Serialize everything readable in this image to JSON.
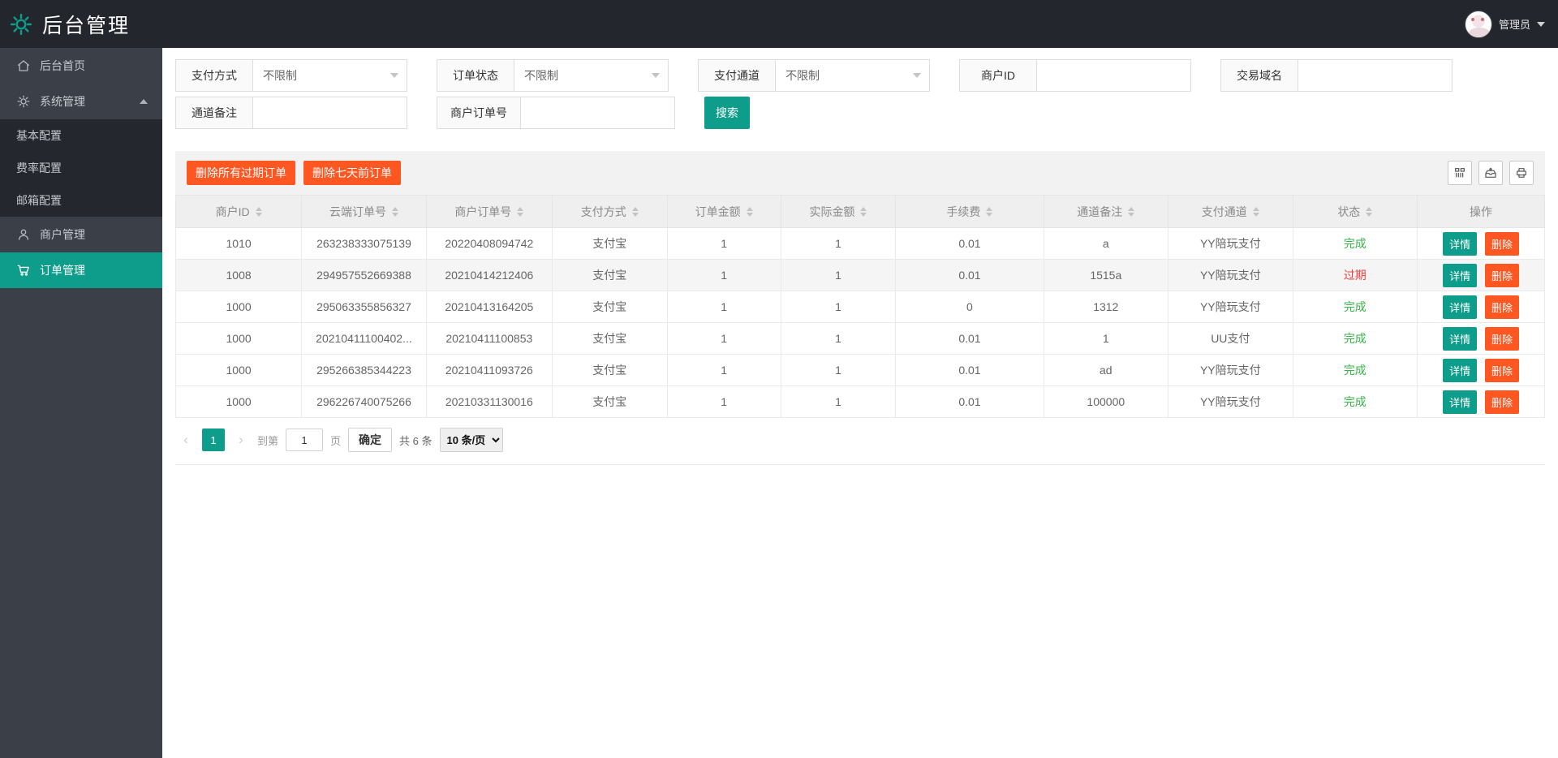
{
  "app": {
    "title": "后台管理"
  },
  "colors": {
    "accent": "#0e9d8a",
    "orange": "#ff5722",
    "green": "#39b54a",
    "red": "#f03e3e"
  },
  "header": {
    "user_name": "管理员"
  },
  "sidebar": {
    "items": [
      {
        "label": "后台首页",
        "icon": "home-icon"
      },
      {
        "label": "系统管理",
        "icon": "gear-icon",
        "expanded": true
      },
      {
        "label": "基本配置"
      },
      {
        "label": "费率配置"
      },
      {
        "label": "邮箱配置"
      },
      {
        "label": "商户管理",
        "icon": "user-icon"
      },
      {
        "label": "订单管理",
        "icon": "cart-icon",
        "active": true
      }
    ]
  },
  "filters": {
    "row1": [
      {
        "label": "支付方式",
        "type": "select",
        "value": "不限制"
      },
      {
        "label": "订单状态",
        "type": "select",
        "value": "不限制"
      },
      {
        "label": "支付通道",
        "type": "select",
        "value": "不限制"
      },
      {
        "label": "商户ID",
        "type": "input",
        "value": ""
      },
      {
        "label": "交易域名",
        "type": "input",
        "value": ""
      }
    ],
    "row2": [
      {
        "label": "通道备注",
        "type": "input",
        "value": ""
      },
      {
        "label": "商户订单号",
        "type": "input",
        "value": ""
      }
    ],
    "search_label": "搜索"
  },
  "toolbar": {
    "delete_expired_label": "删除所有过期订单",
    "delete_week_label": "删除七天前订单",
    "icons": [
      "columns-icon",
      "export-icon",
      "print-icon"
    ]
  },
  "table": {
    "columns": [
      {
        "label": "商户ID",
        "sortable": true
      },
      {
        "label": "云端订单号",
        "sortable": true
      },
      {
        "label": "商户订单号",
        "sortable": true
      },
      {
        "label": "支付方式",
        "sortable": true
      },
      {
        "label": "订单金额",
        "sortable": true
      },
      {
        "label": "实际金额",
        "sortable": true
      },
      {
        "label": "手续费",
        "sortable": true
      },
      {
        "label": "通道备注",
        "sortable": true
      },
      {
        "label": "支付通道",
        "sortable": true
      },
      {
        "label": "状态",
        "sortable": true
      },
      {
        "label": "操作",
        "sortable": false
      }
    ],
    "actions": {
      "detail": "详情",
      "delete": "删除"
    },
    "rows": [
      {
        "merchant_id": "1010",
        "cloud_order_no": "263238333075139",
        "merchant_order_no": "20220408094742",
        "pay_method": "支付宝",
        "order_amount": "1",
        "actual_amount": "1",
        "fee": "0.01",
        "channel_note": "a",
        "pay_channel": "YY陪玩支付",
        "status": "完成",
        "status_color": "#39b54a"
      },
      {
        "merchant_id": "1008",
        "cloud_order_no": "294957552669388",
        "merchant_order_no": "20210414212406",
        "pay_method": "支付宝",
        "order_amount": "1",
        "actual_amount": "1",
        "fee": "0.01",
        "channel_note": "1515a",
        "pay_channel": "YY陪玩支付",
        "status": "过期",
        "status_color": "#f03e3e"
      },
      {
        "merchant_id": "1000",
        "cloud_order_no": "295063355856327",
        "merchant_order_no": "20210413164205",
        "pay_method": "支付宝",
        "order_amount": "1",
        "actual_amount": "1",
        "fee": "0",
        "channel_note": "1312",
        "pay_channel": "YY陪玩支付",
        "status": "完成",
        "status_color": "#39b54a"
      },
      {
        "merchant_id": "1000",
        "cloud_order_no": "20210411100402...",
        "merchant_order_no": "20210411100853",
        "pay_method": "支付宝",
        "order_amount": "1",
        "actual_amount": "1",
        "fee": "0.01",
        "channel_note": "1",
        "pay_channel": "UU支付",
        "status": "完成",
        "status_color": "#39b54a"
      },
      {
        "merchant_id": "1000",
        "cloud_order_no": "295266385344223",
        "merchant_order_no": "20210411093726",
        "pay_method": "支付宝",
        "order_amount": "1",
        "actual_amount": "1",
        "fee": "0.01",
        "channel_note": "ad",
        "pay_channel": "YY陪玩支付",
        "status": "完成",
        "status_color": "#39b54a"
      },
      {
        "merchant_id": "1000",
        "cloud_order_no": "296226740075266",
        "merchant_order_no": "20210331130016",
        "pay_method": "支付宝",
        "order_amount": "1",
        "actual_amount": "1",
        "fee": "0.01",
        "channel_note": "100000",
        "pay_channel": "YY陪玩支付",
        "status": "完成",
        "status_color": "#39b54a"
      }
    ]
  },
  "pagination": {
    "current_page": "1",
    "goto_prefix": "到第",
    "goto_value": "1",
    "goto_suffix": "页",
    "confirm_label": "确定",
    "total_label": "共 6 条",
    "page_size_label": "10 条/页"
  }
}
